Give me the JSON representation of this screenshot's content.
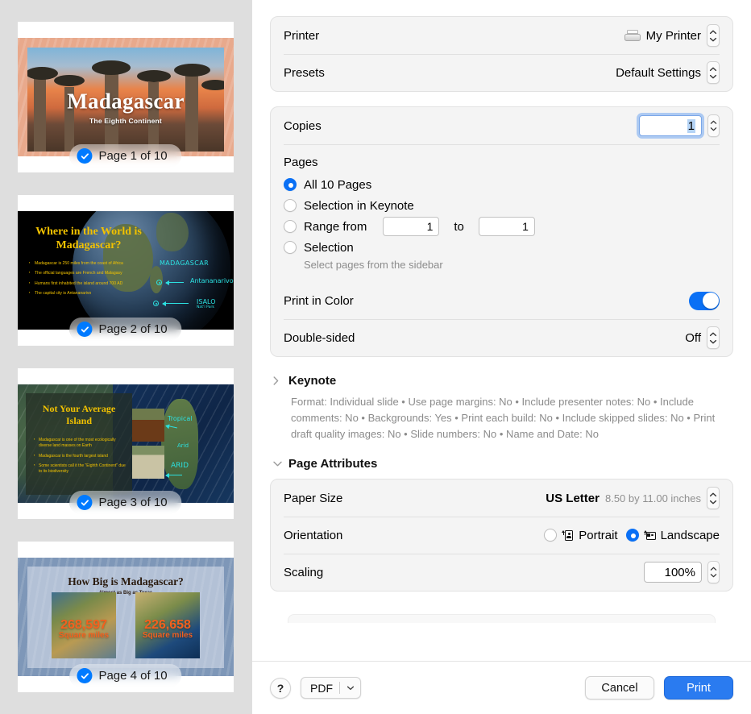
{
  "sidebar": {
    "pages": [
      {
        "badge": "Page 1 of 10",
        "title": "Madagascar",
        "subtitle": "The Eighth Continent"
      },
      {
        "badge": "Page 2 of 10",
        "title": "Where in the World is Madagascar?",
        "bullets": [
          "Madagascar is 250 miles from the coast of Africa",
          "The official languages are French and Malagasy",
          "Humans first inhabited the island around 700 AD",
          "The capital city is Antananarivo"
        ],
        "annotations": {
          "country": "MADAGASCAR",
          "capital": "Antananarivo",
          "park": "ISALO",
          "park_sub": "Nat'l Park"
        }
      },
      {
        "badge": "Page 3 of 10",
        "title": "Not Your Average Island",
        "bullets": [
          "Madagascar is one of the most ecologically diverse land masses on Earth",
          "Madagascar is the fourth largest island",
          "Some scientists call it the \"Eighth Continent\" due to its biodiversity"
        ],
        "annotations": {
          "tropical": "Tropical",
          "arid_small": "Arid",
          "arid": "ARID"
        }
      },
      {
        "badge": "Page 4 of 10",
        "title": "How Big is Madagascar?",
        "subtitle": "Almost as Big as Texas",
        "stats": [
          {
            "number": "268,597",
            "unit": "Square miles"
          },
          {
            "number": "226,658",
            "unit": "Square miles"
          }
        ]
      }
    ]
  },
  "printer": {
    "label": "Printer",
    "value": "My Printer",
    "icon": "printer-icon"
  },
  "presets": {
    "label": "Presets",
    "value": "Default Settings"
  },
  "copies": {
    "label": "Copies",
    "value": "1"
  },
  "pages": {
    "label": "Pages",
    "options": [
      {
        "label": "All 10 Pages",
        "selected": true
      },
      {
        "label": "Selection in Keynote",
        "selected": false
      },
      {
        "label": "Range from",
        "selected": false
      },
      {
        "label": "Selection",
        "selected": false
      }
    ],
    "range_from": "1",
    "range_to": "1",
    "range_to_label": "to",
    "hint": "Select pages from the sidebar"
  },
  "print_in_color": {
    "label": "Print in Color",
    "state": "on"
  },
  "double_sided": {
    "label": "Double-sided",
    "value": "Off"
  },
  "keynote_section": {
    "title": "Keynote",
    "expanded": false,
    "summary": "Format: Individual slide • Use page margins: No • Include presenter notes: No • Include comments: No • Backgrounds: Yes • Print each build: No • Include skipped slides: No • Print draft quality images: No • Slide numbers: No • Name and Date: No"
  },
  "page_attributes": {
    "title": "Page Attributes",
    "expanded": true,
    "paper_size": {
      "label": "Paper Size",
      "value": "US Letter",
      "dimensions": "8.50 by 11.00 inches"
    },
    "orientation": {
      "label": "Orientation",
      "options": [
        {
          "label": "Portrait",
          "selected": false
        },
        {
          "label": "Landscape",
          "selected": true
        }
      ]
    },
    "scaling": {
      "label": "Scaling",
      "value": "100%"
    }
  },
  "toolbar": {
    "help_label": "?",
    "pdf_label": "PDF",
    "cancel_label": "Cancel",
    "print_label": "Print"
  },
  "colors": {
    "accent": "#0a70f5",
    "print_button": "#2a7bf0",
    "sidebar_bg": "#dedede",
    "card_bg": "#f4f4f4"
  }
}
